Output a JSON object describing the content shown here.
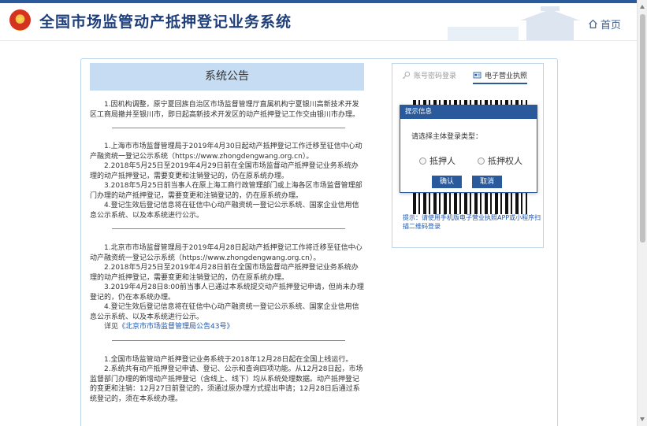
{
  "header": {
    "title": "全国市场监管动产抵押登记业务系统",
    "home_label": "首页",
    "brand_color": "#2a5a9c",
    "icons": [
      "national-emblem",
      "home-icon"
    ]
  },
  "notice": {
    "heading": "系统公告",
    "block1": {
      "p1": "1.因机构调整，原宁夏回族自治区市场监督管理厅直属机构宁夏银川高新技术开发区工商局撤并至银川市，即日起高新技术开发区的动产抵押登记工作交由银川市办理。"
    },
    "block2": {
      "p1": "1.上海市市场监督管理局于2019年4月30日起动产抵押登记工作迁移至征信中心动产融资统一登记公示系统（https://www.zhongdengwang.org.cn）。",
      "p2": "2.2018年5月25日至2019年4月29日前在全国市场监督动产抵押登记业务系统办理的动产抵押登记，需要变更和注销登记的，仍在原系统办理。",
      "p3": "3.2018年5月25日前当事人在原上海工商行政管理部门或上海各区市场监督管理部门办理的动产抵押登记，需要变更和注销登记的，仍在原系统办理。",
      "p4": "4.登记生效后登记信息将在征信中心动产融资统一登记公示系统、国家企业信用信息公示系统、以及本系统进行公示。"
    },
    "block3": {
      "p1": "1.北京市市场监督管理局于2019年4月28日起动产抵押登记工作将迁移至征信中心动产融资统一登记公示系统（https://www.zhongdengwang.org.cn）。",
      "p2": "2.2018年5月25日至2019年4月28日前在全国市场监督动产抵押登记业务系统办理的动产抵押登记，需要变更和注销登记的，仍在原系统办理。",
      "p3": "3.2019年4月28日8:00前当事人已通过本系统提交动产抵押登记申请，但尚未办理登记的，仍在本系统办理。",
      "p4": "4.登记生效后登记信息将在征信中心动产融资统一登记公示系统、国家企业信用信息公示系统、以及本系统进行公示。",
      "p5_prefix": "详见",
      "p5_link": "《北京市市场监督管理局公告43号》"
    },
    "block4": {
      "p1": "1.全国市场监管动产抵押登记业务系统于2018年12月28日起在全国上线运行。",
      "p2": "2.系统共有动产抵押登记申请、登记、公示和查询四项功能。从12月28日起，市场监督部门办理的新增动产抵押登记（含线上、线下）均从系统处理数据。动产抵押登记的变更和注销：12月27日前登记的，须通过原办理方式提出申请；12月28日后通过系统登记的，须在本系统办理。"
    }
  },
  "login": {
    "tab_account": "账号密码登录",
    "tab_license": "电子营业执照",
    "hint": "提示：请使用手机版电子营业执照APP或小程序扫描二维码登录"
  },
  "dialog": {
    "title": "提示信息",
    "prompt": "请选择主体登录类型：",
    "option_mortgagor": "抵押人",
    "option_mortgagee": "抵押权人",
    "confirm": "确认",
    "cancel": "取消"
  }
}
